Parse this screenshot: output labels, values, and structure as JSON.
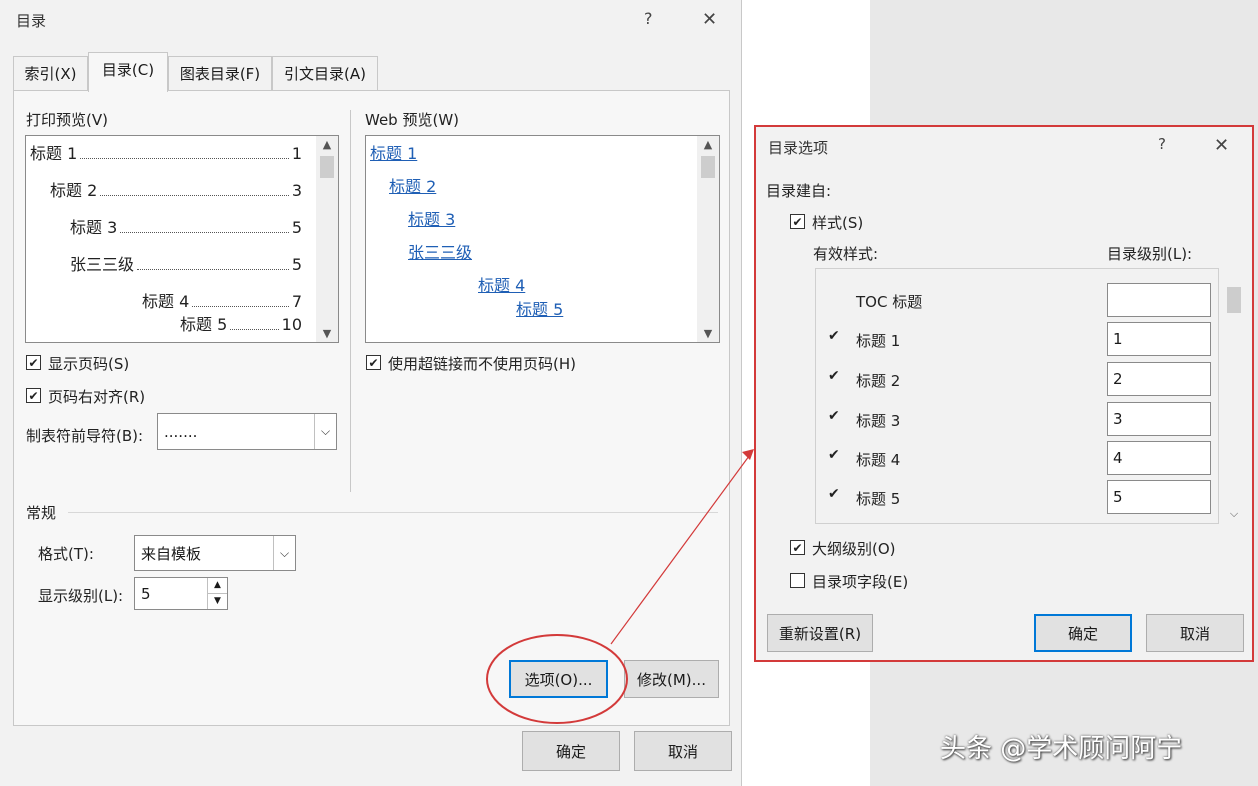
{
  "main_dialog": {
    "title": "目录",
    "help": "?",
    "close": "✕",
    "tabs": [
      {
        "label": "索引(X)"
      },
      {
        "label": "目录(C)"
      },
      {
        "label": "图表目录(F)"
      },
      {
        "label": "引文目录(A)"
      }
    ],
    "print_preview": {
      "label": "打印预览(V)",
      "lines": [
        {
          "text": "标题 1",
          "page": "1"
        },
        {
          "text": "标题 2",
          "page": "3"
        },
        {
          "text": "标题 3",
          "page": "5"
        },
        {
          "text": "张三三级",
          "page": "5"
        },
        {
          "text": "标题 4",
          "page": "7"
        },
        {
          "text": "标题 5",
          "page": "10"
        }
      ]
    },
    "web_preview": {
      "label": "Web 预览(W)",
      "links": [
        "标题 1",
        "标题 2",
        "标题 3",
        "张三三级",
        "标题 4",
        "标题 5"
      ]
    },
    "show_page_numbers": {
      "label": "显示页码(S)",
      "checked": true
    },
    "right_align": {
      "label": "页码右对齐(R)",
      "checked": true
    },
    "hyperlinks": {
      "label": "使用超链接而不使用页码(H)",
      "checked": true
    },
    "tab_leader": {
      "label": "制表符前导符(B):",
      "value": "......."
    },
    "general": {
      "label": "常规",
      "format_label": "格式(T):",
      "format_value": "来自模板",
      "levels_label": "显示级别(L):",
      "levels_value": "5"
    },
    "options_button": "选项(O)...",
    "modify_button": "修改(M)...",
    "ok_button": "确定",
    "cancel_button": "取消"
  },
  "options_dialog": {
    "title": "目录选项",
    "help": "?",
    "close": "✕",
    "build_from": "目录建自:",
    "styles_cb": {
      "label": "样式(S)",
      "checked": true
    },
    "col_styles": "有效样式:",
    "col_level": "目录级别(L):",
    "rows": [
      {
        "name": "TOC 标题",
        "checked": false,
        "level": ""
      },
      {
        "name": "标题 1",
        "checked": true,
        "level": "1"
      },
      {
        "name": "标题 2",
        "checked": true,
        "level": "2"
      },
      {
        "name": "标题 3",
        "checked": true,
        "level": "3"
      },
      {
        "name": "标题 4",
        "checked": true,
        "level": "4"
      },
      {
        "name": "标题 5",
        "checked": true,
        "level": "5"
      }
    ],
    "outline_cb": {
      "label": "大纲级别(O)",
      "checked": true
    },
    "fields_cb": {
      "label": "目录项字段(E)",
      "checked": false
    },
    "reset_button": "重新设置(R)",
    "ok_button": "确定",
    "cancel_button": "取消"
  },
  "watermark": "头条 @学术顾问阿宁",
  "colors": {
    "highlight": "#d33a3a",
    "link": "#1f5fb5",
    "primary_border": "#0078d7"
  }
}
